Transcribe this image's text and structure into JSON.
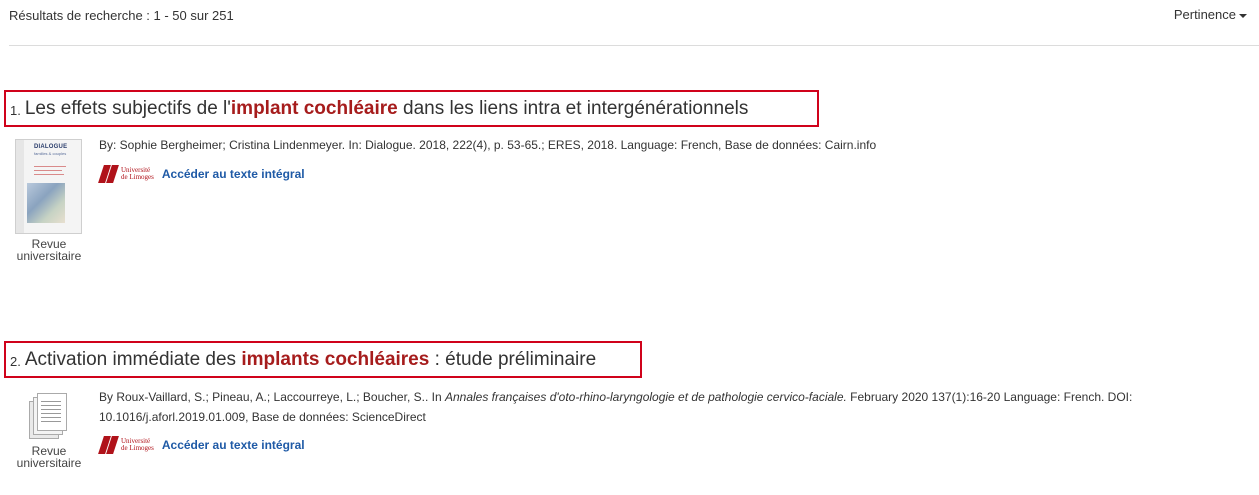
{
  "header": {
    "result_count": "Résultats de recherche : 1 - 50 sur 251",
    "sort_label": "Pertinence"
  },
  "results": [
    {
      "number": "1.",
      "title_before": "Les effets subjectifs de l'",
      "title_highlight": "implant cochléaire",
      "title_after": " dans les liens intra et intergénérationnels",
      "details": "By: Sophie Bergheimer; Cristina Lindenmeyer. In: Dialogue. 2018, 222(4), p. 53-65.; ERES, 2018. Language: French, Base de données: Cairn.info",
      "thumb_label": "Revue universitaire",
      "cover_title": "DIALOGUE",
      "cover_subtitle": "familles & couples",
      "library_logo": "Université de Limoges",
      "fulltext_link": "Accéder au texte intégral"
    },
    {
      "number": "2.",
      "title_before": "Activation immédiate des ",
      "title_highlight": "implants cochléaires",
      "title_after": " : étude préliminaire",
      "details_authors": "By Roux-Vaillard, S.; Pineau, A.; Laccourreye, L.; Boucher, S.. In ",
      "details_journal": "Annales françaises d'oto-rhino-laryngologie et de pathologie cervico-faciale.",
      "details_rest": " February 2020 137(1):16-20 Language: French. DOI: 10.1016/j.aforl.2019.01.009, Base de données: ScienceDirect",
      "thumb_label": "Revue universitaire",
      "library_logo": "Université de Limoges",
      "fulltext_link": "Accéder au texte intégral"
    }
  ],
  "colors": {
    "highlight": "#a61c1c",
    "box_border": "#d0021b",
    "link": "#1f5aa6",
    "logo": "#b0121a"
  }
}
